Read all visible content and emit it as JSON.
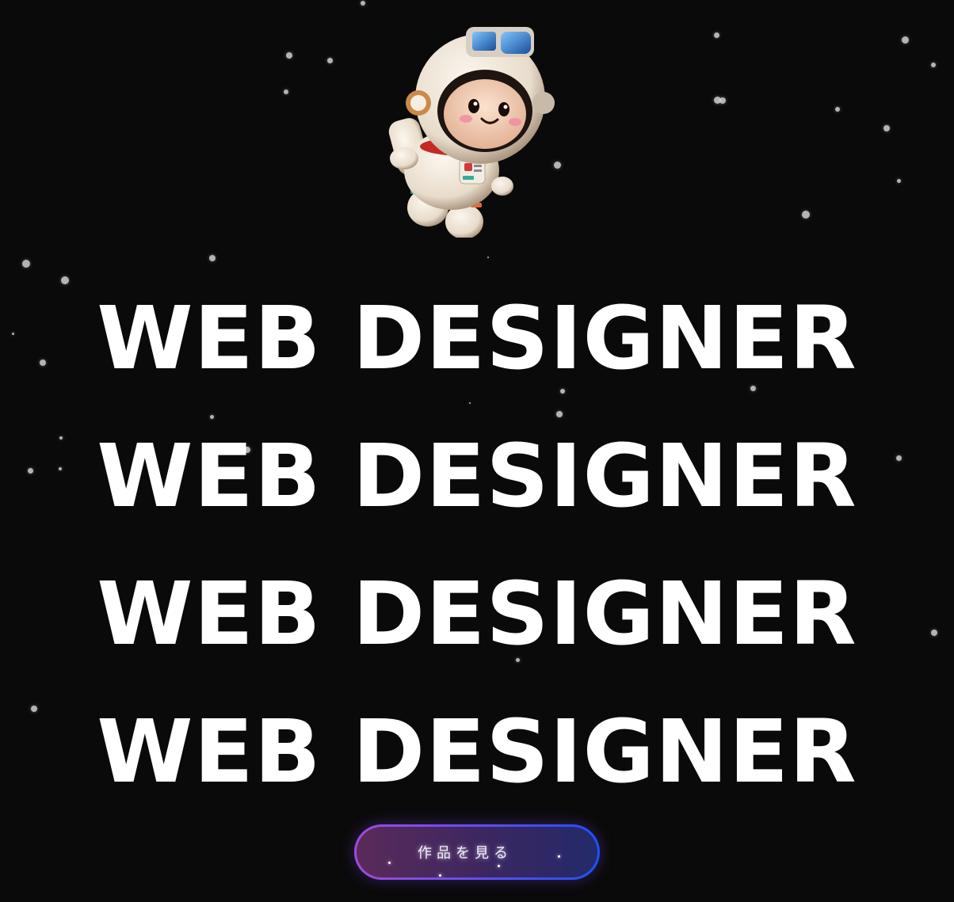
{
  "hero": {
    "headline_lines": [
      "WEB DESIGNER",
      "WEB DESIGNER",
      "WEB DESIGNER",
      "WEB DESIGNER"
    ],
    "mascot_icon": "astronaut-icon"
  },
  "cta": {
    "label": "作品を見る"
  },
  "colors": {
    "background": "#0b0a0a",
    "headline": "#ffffff",
    "button_gradient_start": "#a04bd8",
    "button_gradient_end": "#1f4fff"
  }
}
